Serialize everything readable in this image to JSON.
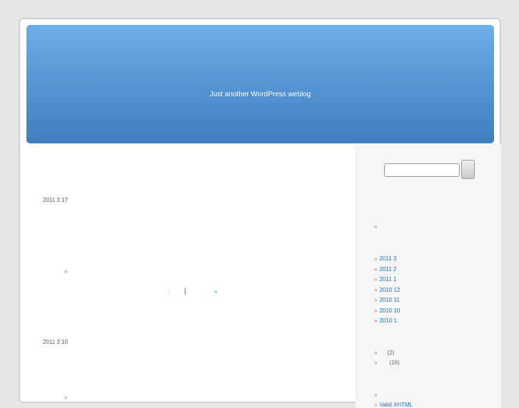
{
  "header": {
    "description": "Just another WordPress weblog"
  },
  "posts": [
    {
      "date": "2011 3 17",
      "more": "»",
      "meta_sep": ":",
      "meta_bar": "|",
      "comments": "»"
    },
    {
      "date": "2011 3 10",
      "more": "»"
    }
  ],
  "sidebar": {
    "bullet": "»",
    "archives": [
      "2011 3",
      "2011 2",
      "2011 1",
      "2010 12",
      "2010 11",
      "2010 10",
      "2010 1"
    ],
    "categories": [
      {
        "count": "(2)"
      },
      {
        "count": "(16)"
      }
    ],
    "meta": [
      "Valid XHTML"
    ]
  }
}
